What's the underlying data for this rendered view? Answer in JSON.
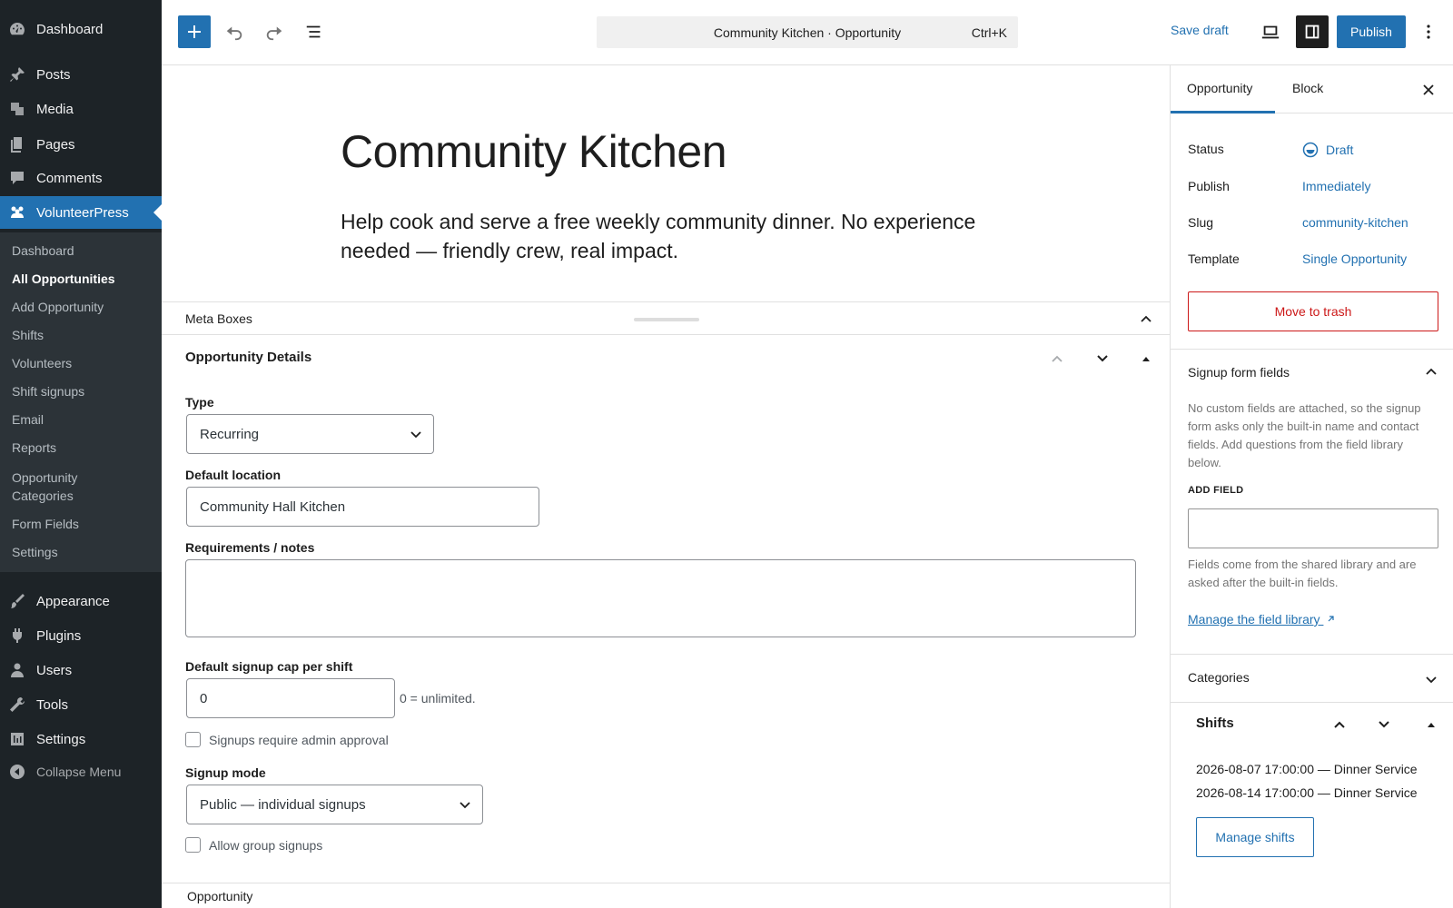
{
  "admin_menu": {
    "items": [
      {
        "label": "Dashboard",
        "icon": "dashboard-icon"
      },
      {
        "label": "Posts",
        "icon": "pin-icon"
      },
      {
        "label": "Media",
        "icon": "media-icon"
      },
      {
        "label": "Pages",
        "icon": "pages-icon"
      },
      {
        "label": "Comments",
        "icon": "comment-icon"
      },
      {
        "label": "VolunteerPress",
        "icon": "volunteers-icon"
      },
      {
        "label": "Appearance",
        "icon": "brush-icon"
      },
      {
        "label": "Plugins",
        "icon": "plugin-icon"
      },
      {
        "label": "Users",
        "icon": "user-icon"
      },
      {
        "label": "Tools",
        "icon": "wrench-icon"
      },
      {
        "label": "Settings",
        "icon": "settings-icon"
      }
    ],
    "submenu": [
      "Dashboard",
      "All Opportunities",
      "Add Opportunity",
      "Shifts",
      "Volunteers",
      "Shift signups",
      "Email",
      "Reports",
      "Opportunity Categories",
      "Form Fields",
      "Settings"
    ],
    "collapse_label": "Collapse Menu"
  },
  "toolbar": {
    "doc_title": "Community Kitchen · Opportunity",
    "shortcut": "Ctrl+K",
    "save_draft": "Save draft",
    "publish": "Publish"
  },
  "post": {
    "title": "Community Kitchen",
    "excerpt": "Help cook and serve a free weekly community dinner. No experience needed — friendly crew, real impact."
  },
  "metaboxes": {
    "header": "Meta Boxes",
    "details_title": "Opportunity Details",
    "type_label": "Type",
    "type_value": "Recurring",
    "location_label": "Default location",
    "location_value": "Community Hall Kitchen",
    "requirements_label": "Requirements / notes",
    "cap_label": "Default signup cap per shift",
    "cap_value": "0",
    "cap_hint": "0 = unlimited.",
    "approval_label": "Signups require admin approval",
    "mode_label": "Signup mode",
    "mode_value": "Public — individual signups",
    "group_label": "Allow group signups"
  },
  "footer": {
    "breadcrumb": "Opportunity"
  },
  "panel": {
    "tabs": [
      "Opportunity",
      "Block"
    ],
    "status_label": "Status",
    "status_value": "Draft",
    "publish_label": "Publish",
    "publish_value": "Immediately",
    "slug_label": "Slug",
    "slug_value": "community-kitchen",
    "template_label": "Template",
    "template_value": "Single Opportunity",
    "trash": "Move to trash",
    "signup_title": "Signup form fields",
    "signup_desc": "No custom fields are attached, so the signup form asks only the built-in name and contact fields. Add questions from the field library below.",
    "add_field_label": "ADD FIELD",
    "fields_note": "Fields come from the shared library and are asked after the built-in fields.",
    "manage_library": "Manage the field library",
    "categories_title": "Categories",
    "shifts_title": "Shifts",
    "shifts": [
      "2026-08-07 17:00:00 — Dinner Service",
      "2026-08-14 17:00:00 — Dinner Service"
    ],
    "manage_shifts": "Manage shifts"
  },
  "colors": {
    "accent": "#2271b1",
    "sidebar": "#1d2327",
    "danger": "#cc1818"
  }
}
